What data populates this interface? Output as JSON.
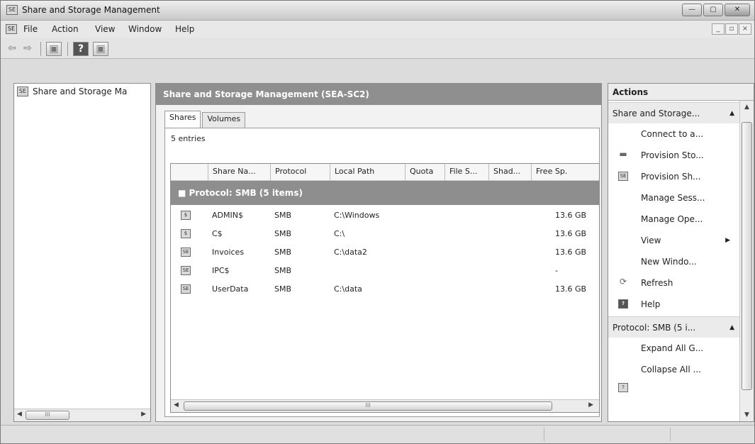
{
  "window": {
    "title": "Share and Storage Management",
    "app_icon": "share-storage-icon",
    "controls": {
      "minimize": "—",
      "maximize": "▢",
      "close": "✕"
    }
  },
  "menubar": {
    "items": [
      "File",
      "Action",
      "View",
      "Window",
      "Help"
    ],
    "mdi_controls": [
      "_",
      "▫",
      "×"
    ]
  },
  "toolbar": {
    "back": "⇦",
    "forward": "⇨",
    "show_hide_tree": "▣",
    "help": "?",
    "show_hide_action": "▣"
  },
  "tree": {
    "root": "Share and Storage Ma",
    "scroll_thumb": "III"
  },
  "center": {
    "header": "Share and Storage Management (SEA-SC2)",
    "tabs": [
      "Shares",
      "Volumes"
    ],
    "entries": "5 entries",
    "columns": [
      "Share Na...",
      "Protocol",
      "Local Path",
      "Quota",
      "File S...",
      "Shad...",
      "Free Sp."
    ],
    "group": "■  Protocol: SMB (5 items)",
    "rows": [
      {
        "icon": "admin-share-icon",
        "name": "ADMIN$",
        "protocol": "SMB",
        "path": "C:\\Windows",
        "free": "13.6 GB"
      },
      {
        "icon": "admin-share-icon",
        "name": "C$",
        "protocol": "SMB",
        "path": "C:\\",
        "free": "13.6 GB"
      },
      {
        "icon": "share-icon",
        "name": "Invoices",
        "protocol": "SMB",
        "path": "C:\\data2",
        "free": "13.6 GB"
      },
      {
        "icon": "share-icon",
        "name": "IPC$",
        "protocol": "SMB",
        "path": "",
        "free": "-"
      },
      {
        "icon": "share-icon",
        "name": "UserData",
        "protocol": "SMB",
        "path": "C:\\data",
        "free": "13.6 GB"
      }
    ],
    "scroll_thumb": "III"
  },
  "actions": {
    "title": "Actions",
    "section1": "Share and Storage...",
    "items1": [
      {
        "label": "Connect to a...",
        "icon": ""
      },
      {
        "label": "Provision Sto...",
        "icon": "disk-icon"
      },
      {
        "label": "Provision Sh...",
        "icon": "share-icon"
      },
      {
        "label": "Manage Sess...",
        "icon": ""
      },
      {
        "label": "Manage Ope...",
        "icon": ""
      },
      {
        "label": "View",
        "icon": "",
        "submenu": "▶"
      },
      {
        "label": "New Windo...",
        "icon": ""
      },
      {
        "label": "Refresh",
        "icon": "refresh-icon"
      },
      {
        "label": "Help",
        "icon": "help-icon"
      }
    ],
    "section2": "Protocol: SMB (5 i...",
    "items2": [
      {
        "label": "Expand All G...",
        "icon": ""
      },
      {
        "label": "Collapse All ...",
        "icon": ""
      }
    ]
  }
}
